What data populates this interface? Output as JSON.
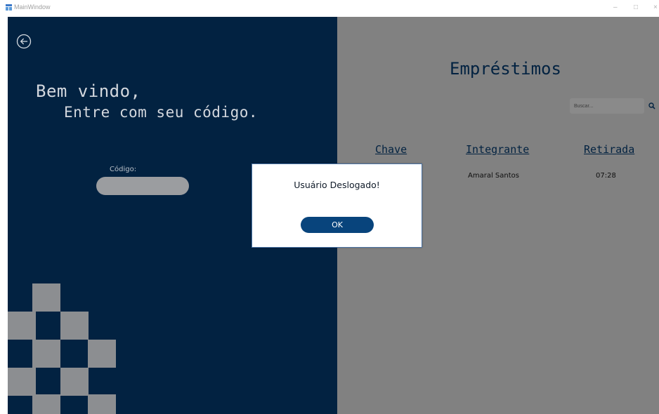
{
  "window": {
    "title": "MainWindow",
    "minimize": "–",
    "restore": "□",
    "close": "×"
  },
  "left": {
    "welcome_line1": "Bem vindo,",
    "welcome_line2": "Entre com seu código.",
    "code_label": "Código:",
    "code_value": ""
  },
  "right": {
    "title": "Empréstimos",
    "search_placeholder": "Buscar...",
    "columns": [
      "Chave",
      "Integrante",
      "Retirada"
    ],
    "rows": [
      {
        "chave": "",
        "integrante": "Amaral Santos",
        "retirada": "07:28"
      }
    ]
  },
  "dialog": {
    "message": "Usuário Deslogado!",
    "ok_label": "OK"
  },
  "colors": {
    "left_panel": "#022241",
    "right_panel": "#818181",
    "accent_button": "#08447c",
    "decor_squares": "#8c8e91"
  },
  "icons": {
    "back": "back-arrow-circle-icon",
    "search": "search-icon",
    "app": "window-app-icon"
  }
}
